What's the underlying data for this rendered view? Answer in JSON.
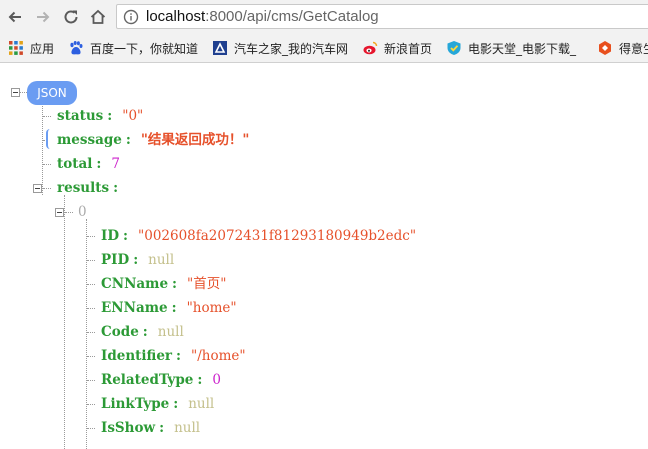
{
  "browser": {
    "url_host": "localhost",
    "url_path": ":8000/api/cms/GetCatalog"
  },
  "bookmarks": [
    {
      "label": "应用",
      "icon": "apps-grid-icon"
    },
    {
      "label": "百度一下，你就知道",
      "icon": "baidu-paw-icon"
    },
    {
      "label": "汽车之家_我的汽车网",
      "icon": "autohome-icon"
    },
    {
      "label": "新浪首页",
      "icon": "sina-weibo-icon"
    },
    {
      "label": "电影天堂_电影下载_",
      "icon": "movie-shield-icon"
    },
    {
      "label": "得意生",
      "icon": "deyi-icon"
    }
  ],
  "json": {
    "root_label": "JSON",
    "status": {
      "key": "status",
      "value": "\"0\""
    },
    "message": {
      "key": "message",
      "value": "\"结果返回成功！\""
    },
    "total": {
      "key": "total",
      "value": "7"
    },
    "results": {
      "key": "results"
    },
    "index": "0",
    "item": [
      {
        "key": "ID",
        "value": "\"002608fa2072431f81293180949b2edc\"",
        "type": "str"
      },
      {
        "key": "PID",
        "value": "null",
        "type": "nul"
      },
      {
        "key": "CNName",
        "value": "\"首页\"",
        "type": "str"
      },
      {
        "key": "ENName",
        "value": "\"home\"",
        "type": "str"
      },
      {
        "key": "Code",
        "value": "null",
        "type": "nul"
      },
      {
        "key": "Identifier",
        "value": "\"/home\"",
        "type": "str"
      },
      {
        "key": "RelatedType",
        "value": "0",
        "type": "num"
      },
      {
        "key": "LinkType",
        "value": "null",
        "type": "nul"
      },
      {
        "key": "IsShow",
        "value": "null",
        "type": "nul"
      }
    ],
    "sep": ":"
  }
}
